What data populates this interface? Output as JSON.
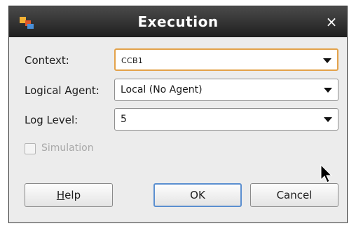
{
  "window": {
    "title": "Execution",
    "close_glyph": "×",
    "app_icon": "app-icon"
  },
  "fields": {
    "context": {
      "label": "Context:",
      "value": "CCB1"
    },
    "logical_agent": {
      "label": "Logical Agent:",
      "value": "Local (No Agent)"
    },
    "log_level": {
      "label": "Log Level:",
      "value": "5"
    }
  },
  "simulation": {
    "label": "Simulation",
    "checked": false,
    "enabled": false
  },
  "buttons": {
    "help_mnemonic": "H",
    "help_rest": "elp",
    "ok": "OK",
    "cancel": "Cancel"
  },
  "colors": {
    "title_bar": "#2b2b2b",
    "focus_border": "#e3a24a",
    "default_button_border": "#5b8fd0"
  }
}
